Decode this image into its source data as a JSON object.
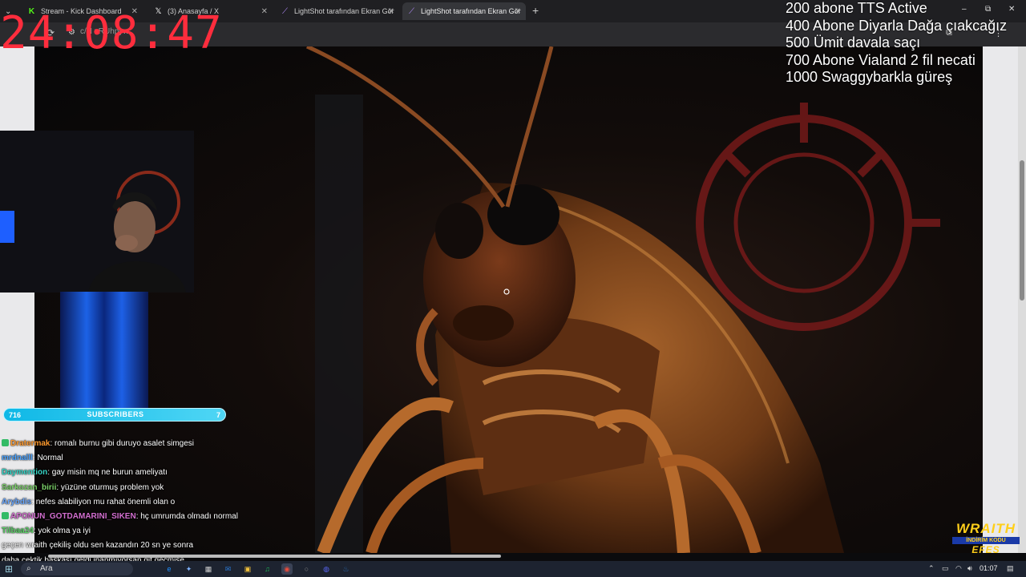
{
  "tabs": [
    {
      "label": "Stream - Kick Dashboard",
      "icon": "kick-icon",
      "active": false
    },
    {
      "label": "(3) Anasayfa / X",
      "icon": "x-logo-icon",
      "active": false
    },
    {
      "label": "LightShot tarafından Ekran Gör",
      "icon": "lightshot-icon",
      "active": false
    },
    {
      "label": "LightShot tarafından Ekran Gör",
      "icon": "lightshot-icon",
      "active": true
    }
  ],
  "address": {
    "url": "c/N   vRUhpyw"
  },
  "overlay": {
    "timer": "24:08:47",
    "goals": [
      "200 abone TTS Active",
      "400 Abone Diyarla Dağa çıakcağız",
      "500 Ümit davala saçı",
      "700 Abone Vialand 2 fil necati",
      "1000 Swaggybarkla güreş"
    ]
  },
  "subscribers": {
    "count": "716",
    "label": "SUBSCRIBERS",
    "goal": "7"
  },
  "chat": [
    {
      "user": "Dratermak",
      "color": "#ff9a2e",
      "text": ": romalı burnu gibi duruyo asalet simgesi",
      "badge": true
    },
    {
      "user": "mrdnalll",
      "color": "#4aa3ff",
      "text": ": Normal",
      "badge": false
    },
    {
      "user": "Daymention",
      "color": "#37d6c8",
      "text": ": gay misin mq ne burun ameliyatı",
      "badge": false
    },
    {
      "user": "Sarkozan_birii",
      "color": "#7cd36a",
      "text": ": yüzüne oturmuş problem yok",
      "badge": false
    },
    {
      "user": "Arybdis",
      "color": "#6ca9ff",
      "text": ": nefes alabiliyon mu rahat önemli olan o",
      "badge": false
    },
    {
      "user": "APONUN_GOTDAMARINI_SIKEN",
      "color": "#d36fd0",
      "text": ": hç umrumda olmadı normal",
      "badge": true
    },
    {
      "user": "Tilbaa24",
      "color": "#5ed36a",
      "text": ": yok olma ya iyi",
      "badge": false
    },
    {
      "user": "",
      "color": "#ffffff",
      "text": "geçen wraith çekiliş oldu sen kazandın 20 sn ye sonra",
      "badge": false
    },
    {
      "user": "",
      "color": "#ffffff",
      "text": "daha çektik başkası geldi inanmıyorsan git geçmişe",
      "badge": false
    }
  ],
  "sponsor": {
    "line1": "WRAITH",
    "line2": "İNDİRİM KODU",
    "line3": "EFES"
  },
  "taskbar": {
    "search_placeholder": "Ara",
    "time": "01:07",
    "apps": [
      "edge-icon",
      "copilot-icon",
      "store-icon",
      "outlook-icon",
      "explorer-icon",
      "spotify-icon",
      "chrome-icon",
      "obs-icon",
      "discord-icon",
      "steam-icon"
    ]
  },
  "window_controls": {
    "minimize": "–",
    "maximize": "⧉",
    "close": "✕"
  }
}
